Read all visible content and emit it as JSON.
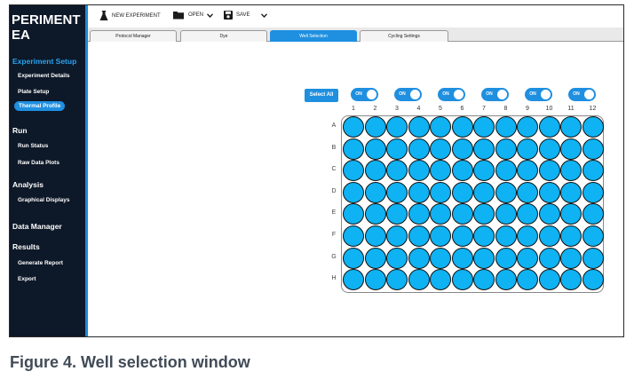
{
  "app": {
    "title": "PERIMENT\nEA"
  },
  "sidebar": {
    "sections": [
      {
        "label": "Experiment Setup",
        "items": [
          "Experiment Details",
          "Plate Setup",
          "Thermal Profile"
        ],
        "active_item": "Thermal Profile"
      },
      {
        "label": "Run",
        "items": [
          "Run Status",
          "Raw Data Plots"
        ]
      },
      {
        "label": "Analysis",
        "items": [
          "Graphical Displays"
        ]
      },
      {
        "label": "Data Manager",
        "items": []
      },
      {
        "label": "Results",
        "items": [
          "Generate Report",
          "Export"
        ]
      }
    ]
  },
  "toolbar": {
    "new_label": "NEW EXPERIMENT",
    "open_label": "OPEN",
    "save_label": "SAVE"
  },
  "tabs": [
    {
      "label": "Protocol Manager",
      "active": false
    },
    {
      "label": "Dye",
      "active": false
    },
    {
      "label": "Well Selection",
      "active": true
    },
    {
      "label": "Cycling Settings",
      "active": false
    }
  ],
  "well_selection": {
    "select_all_label": "Select All",
    "toggle_label": "ON",
    "toggles_count": 6,
    "columns": [
      "1",
      "2",
      "3",
      "4",
      "5",
      "6",
      "7",
      "8",
      "9",
      "10",
      "11",
      "12"
    ],
    "rows": [
      "A",
      "B",
      "C",
      "D",
      "E",
      "F",
      "G",
      "H"
    ],
    "well_color": "#0fb2f2"
  },
  "colors": {
    "accent": "#1f8fe0",
    "sidebar_bg": "#0d1828",
    "section_highlight": "#2ba3ef"
  },
  "caption": "Figure 4. Well selection window"
}
